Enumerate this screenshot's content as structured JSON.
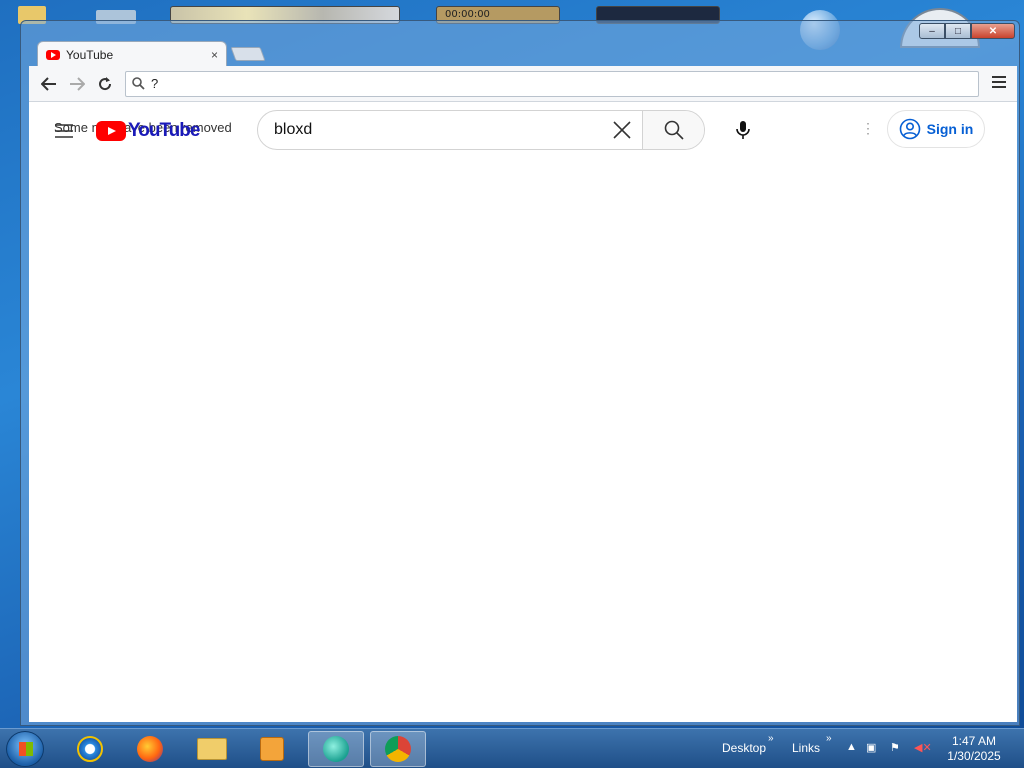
{
  "browser": {
    "tab_title": "YouTube",
    "tab_close": "×",
    "address": "?",
    "menu_icon": "hamburger-menu-icon"
  },
  "youtube": {
    "notice": "Some m... have been removed",
    "logo_text": "YouTube",
    "search_value": "bloxd",
    "sign_in_label": "Sign in",
    "kebab": "⋮"
  },
  "aero_peek": {
    "timer": "00:00:00"
  },
  "taskbar": {
    "desktop_label": "Desktop",
    "links_label": "Links",
    "chevron": "»",
    "time": "1:47 AM",
    "date": "1/30/2025"
  },
  "colors": {
    "youtube_red": "#ff0000",
    "signin_blue": "#065fd4"
  }
}
